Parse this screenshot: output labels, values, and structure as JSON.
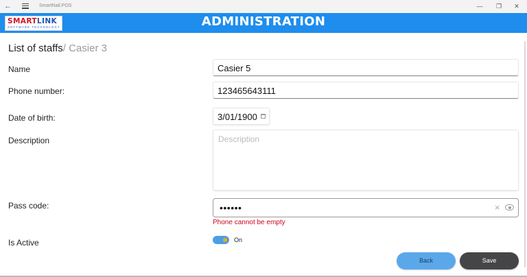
{
  "window": {
    "title": "SmartNail.POS",
    "back_icon": "back-arrow-icon",
    "menu_icon": "hamburger-icon",
    "controls": {
      "minimize": "—",
      "restore": "❐",
      "close": "✕"
    }
  },
  "header": {
    "logo_main_red": "SMART",
    "logo_main_blue": "LINK",
    "logo_sub": "SOFTWARE TECHNOLOGY",
    "title": "ADMINISTRATION",
    "accent_color": "#1e8ded"
  },
  "breadcrumb": {
    "root": "List of staffs",
    "current": "/ Casier 3"
  },
  "form": {
    "name_label": "Name",
    "name_value": "Casier 5",
    "phone_label": "Phone number:",
    "phone_value": "123465643111",
    "dob_label": "Date of birth:",
    "dob_value": "3/01/1900",
    "description_label": "Description",
    "description_placeholder": "Description",
    "passcode_label": "Pass code:",
    "passcode_value": "••••••",
    "passcode_error": "Phone cannot be empty",
    "active_label": "Is Active",
    "active_state": "On",
    "active_on": true
  },
  "actions": {
    "back_label": "Back",
    "save_label": "Save"
  }
}
